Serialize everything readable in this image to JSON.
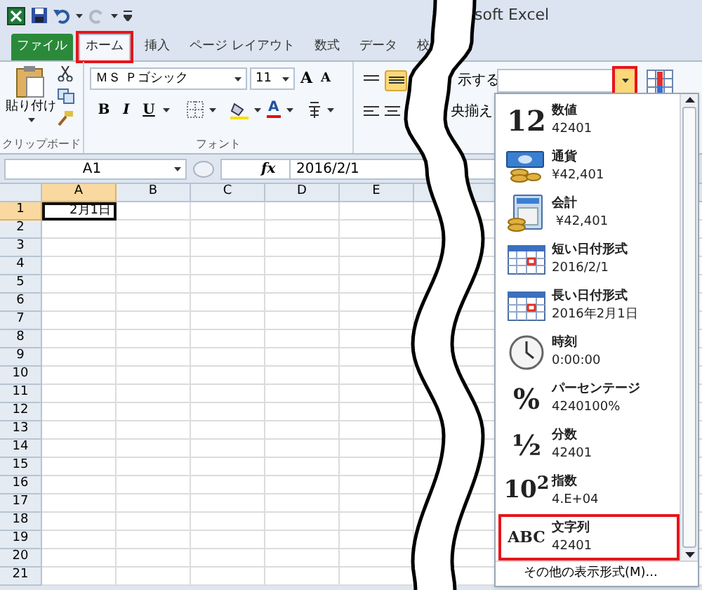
{
  "window_title": "soft Excel",
  "tabs": [
    {
      "label": "ファイル",
      "kind": "file",
      "selected": false,
      "highlighted": false
    },
    {
      "label": "ホーム",
      "kind": "tab",
      "selected": true,
      "highlighted": true
    },
    {
      "label": "挿入",
      "kind": "tab",
      "selected": false,
      "highlighted": false
    },
    {
      "label": "ページ レイアウト",
      "kind": "tab",
      "selected": false,
      "highlighted": false
    },
    {
      "label": "数式",
      "kind": "tab",
      "selected": false,
      "highlighted": false
    },
    {
      "label": "データ",
      "kind": "tab",
      "selected": false,
      "highlighted": false
    },
    {
      "label": "校",
      "kind": "tab",
      "selected": false,
      "highlighted": false
    }
  ],
  "clipboard": {
    "paste_label": "貼り付け",
    "group_label": "クリップボード"
  },
  "font": {
    "name": "ＭＳ Ｐゴシック",
    "size": "11",
    "grow_label": "A",
    "shrink_label": "A",
    "style_buttons": [
      {
        "label": "B",
        "kind": "bold"
      },
      {
        "label": "I",
        "kind": "italic"
      },
      {
        "label": "U",
        "kind": "underline"
      }
    ],
    "color_label": "A",
    "group_label": "フォント"
  },
  "alignment": {
    "wrap_label": "示する",
    "merge_label": "央揃え",
    "vertical_buttons": [
      {
        "selected": false
      },
      {
        "selected": true
      }
    ]
  },
  "number_format": {
    "dropdown_highlighted": true
  },
  "formula_bar": {
    "name_box": "A1",
    "function_label": "fx",
    "value": "2016/2/1"
  },
  "sheet": {
    "columns": [
      {
        "label": "A",
        "selected": true
      },
      {
        "label": "B",
        "selected": false
      },
      {
        "label": "C",
        "selected": false
      },
      {
        "label": "D",
        "selected": false
      },
      {
        "label": "E",
        "selected": false
      }
    ],
    "rows": [
      {
        "label": "1",
        "selected": true
      },
      {
        "label": "2",
        "selected": false
      },
      {
        "label": "3",
        "selected": false
      },
      {
        "label": "4",
        "selected": false
      },
      {
        "label": "5",
        "selected": false
      },
      {
        "label": "6",
        "selected": false
      },
      {
        "label": "7",
        "selected": false
      },
      {
        "label": "8",
        "selected": false
      },
      {
        "label": "9",
        "selected": false
      },
      {
        "label": "10",
        "selected": false
      },
      {
        "label": "11",
        "selected": false
      },
      {
        "label": "12",
        "selected": false
      },
      {
        "label": "13",
        "selected": false
      },
      {
        "label": "14",
        "selected": false
      },
      {
        "label": "15",
        "selected": false
      },
      {
        "label": "16",
        "selected": false
      },
      {
        "label": "17",
        "selected": false
      },
      {
        "label": "18",
        "selected": false
      },
      {
        "label": "19",
        "selected": false
      },
      {
        "label": "20",
        "selected": false
      },
      {
        "label": "21",
        "selected": false
      }
    ],
    "active_cell": {
      "value": "2月1日"
    }
  },
  "format_menu": {
    "items": [
      {
        "name": "数値",
        "sample": "42401",
        "kind": "glyph",
        "icon_text": "12",
        "highlighted": false
      },
      {
        "name": "通貨",
        "sample": "¥42,401",
        "kind": "currency",
        "highlighted": false
      },
      {
        "name": "会計",
        "sample": " ¥42,401",
        "kind": "accounting",
        "highlighted": false
      },
      {
        "name": "短い日付形式",
        "sample": "2016/2/1",
        "kind": "calendar",
        "highlighted": false
      },
      {
        "name": "長い日付形式",
        "sample": "2016年2月1日",
        "kind": "calendar",
        "highlighted": false
      },
      {
        "name": "時刻",
        "sample": "0:00:00",
        "kind": "clock",
        "highlighted": false
      },
      {
        "name": "パーセンテージ",
        "sample": "4240100%",
        "kind": "glyph",
        "icon_text": "%",
        "highlighted": false
      },
      {
        "name": "分数",
        "sample": "42401",
        "kind": "glyph",
        "icon_text": "½",
        "highlighted": false
      },
      {
        "name": "指数",
        "sample": "4.E+04",
        "kind": "glyph",
        "icon_text": "10$^{2}$",
        "highlighted": false
      },
      {
        "name": "文字列",
        "sample": "42401",
        "kind": "glyph",
        "icon_text": "ABC",
        "highlighted": true
      }
    ],
    "footer": "その他の表示形式(M)..."
  }
}
